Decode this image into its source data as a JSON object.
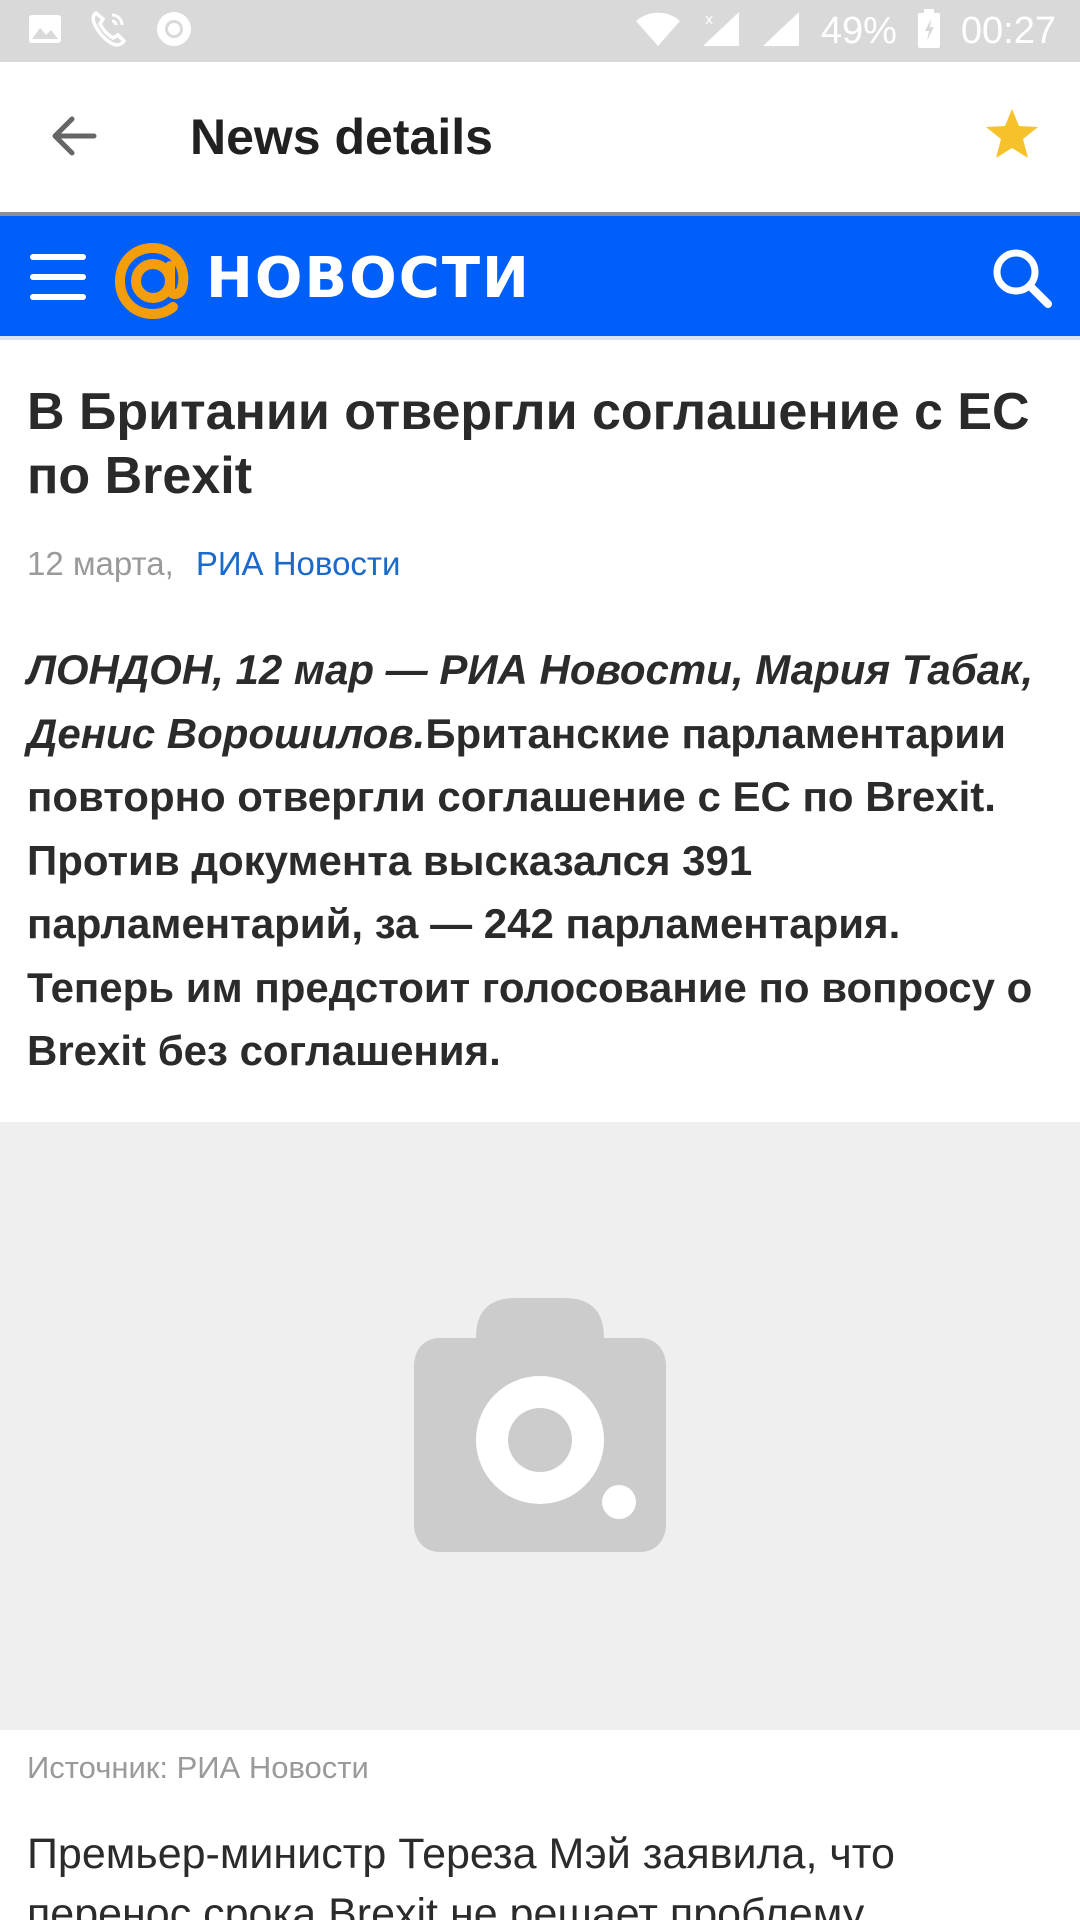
{
  "status_bar": {
    "battery": "49%",
    "time": "00:27",
    "icons": [
      "image-icon",
      "phone-icon",
      "sync-icon",
      "wifi-icon",
      "signal-icon",
      "signal-icon",
      "battery-icon"
    ]
  },
  "app_bar": {
    "title": "News details",
    "back_icon": "arrow-left-icon",
    "favorite_icon": "star-icon",
    "favorite_color": "#f6c22b"
  },
  "brand_bar": {
    "name": "НОВОСТИ",
    "background": "#005ff9",
    "logo_color": "#f59e0b",
    "menu_icon": "hamburger-icon",
    "search_icon": "search-icon"
  },
  "article": {
    "title": "В Британии отвергли соглашение с ЕС по Brexit",
    "date": "12 марта,",
    "source": "РИА Новости",
    "lead_intro": "ЛОНДОН, 12 мар — РИА Новости, Мария Табак, Денис Ворошилов.",
    "lead_text": "Британские парламентарии повторно отвергли соглашение с ЕС по Brexit. Против документа высказался 391 парламентарий, за — 242 парламентария. Теперь им предстоит голосование по вопросу о Brexit без соглашения.",
    "image_placeholder_icon": "camera-icon",
    "image_source": "Источник: РИА Новости",
    "body": "Премьер-министр Тереза Мэй заявила, что перенос срока Brexit не решает проблему"
  }
}
